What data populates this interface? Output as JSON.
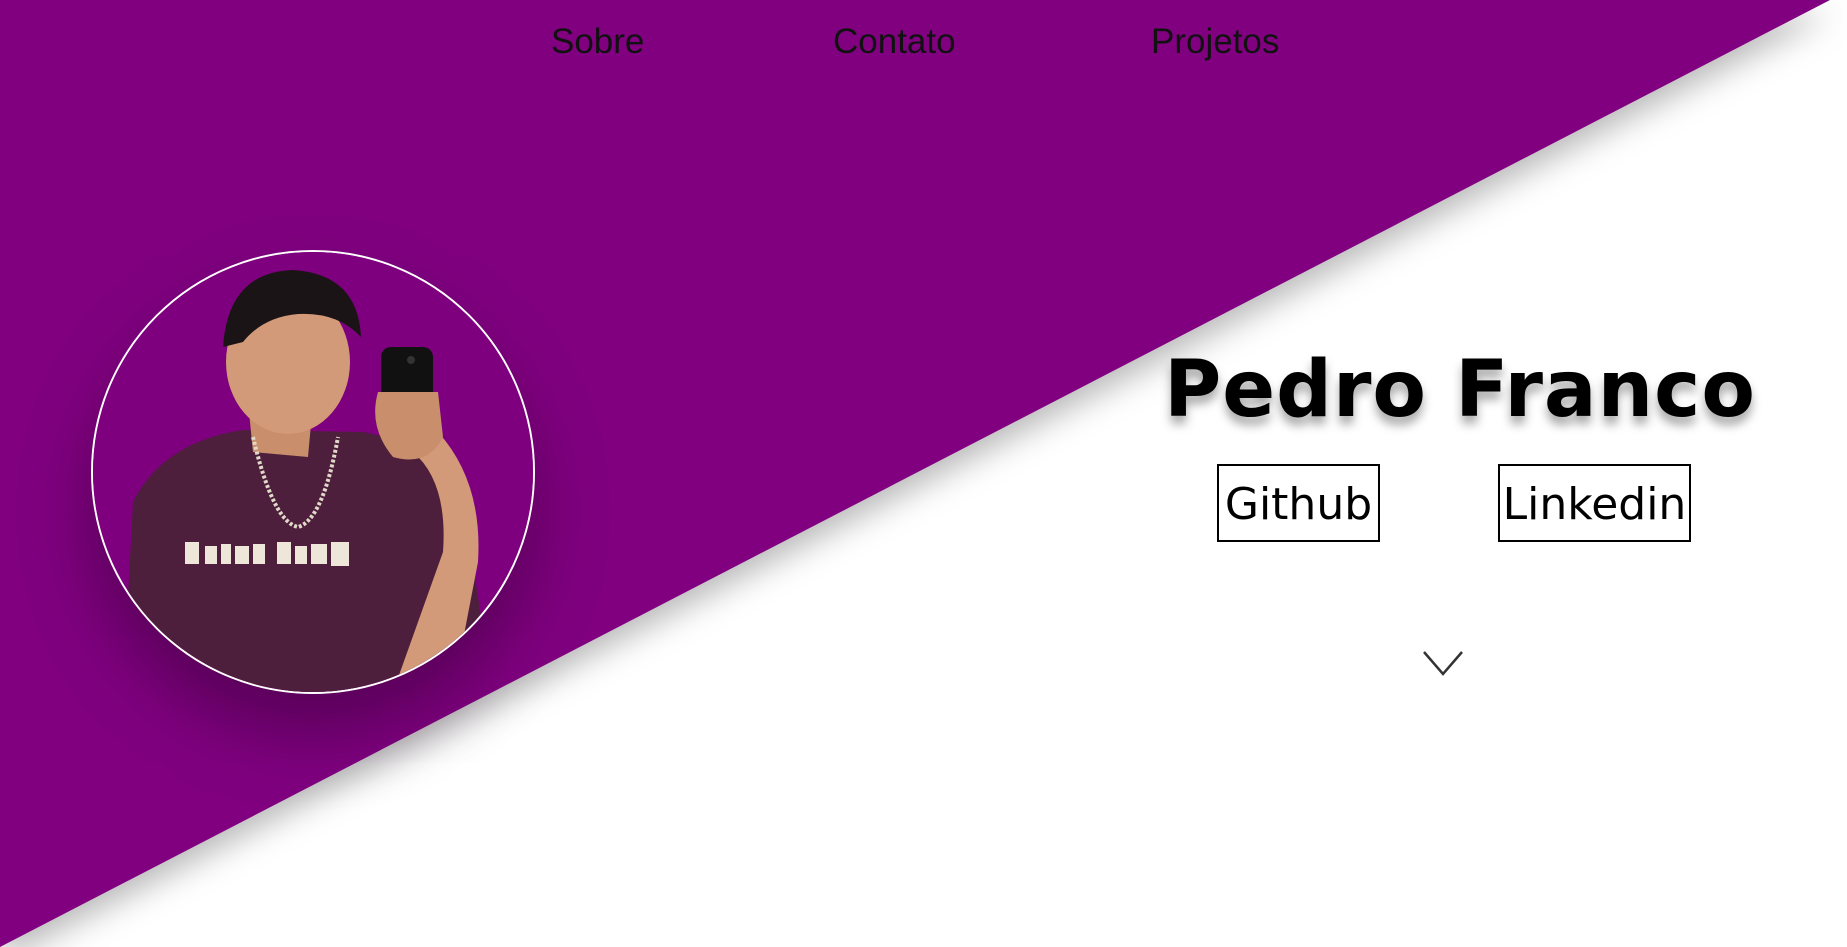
{
  "nav": {
    "items": [
      {
        "label": "Sobre"
      },
      {
        "label": "Contato"
      },
      {
        "label": "Projetos"
      }
    ]
  },
  "hero": {
    "name": "Pedro Franco",
    "buttons": {
      "github": "Github",
      "linkedin": "Linkedin"
    },
    "scroll_icon": "chevron-down-icon"
  },
  "colors": {
    "accent": "#800080",
    "background": "#ffffff",
    "text": "#000000"
  }
}
